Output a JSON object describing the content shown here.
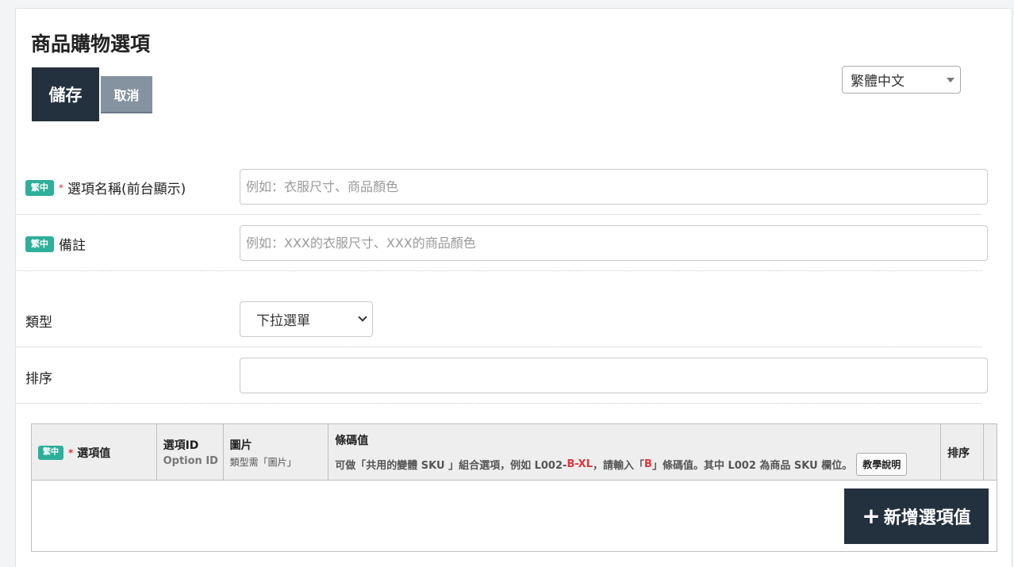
{
  "page": {
    "title": "商品購物選項"
  },
  "toolbar": {
    "save_label": "儲存",
    "cancel_label": "取消"
  },
  "language": {
    "selected": "繁體中文"
  },
  "form": {
    "lang_badge": "繁中",
    "required_mark": "*",
    "option_name": {
      "label": "選項名稱(前台顯示)",
      "placeholder": "例如：衣服尺寸、商品顏色",
      "value": ""
    },
    "remark": {
      "label": "備註",
      "placeholder": "例如：XXX的衣服尺寸、XXX的商品顏色",
      "value": ""
    },
    "type": {
      "label": "類型",
      "selected": "下拉選單"
    },
    "sort": {
      "label": "排序",
      "value": ""
    }
  },
  "options_table": {
    "col_value": "選項值",
    "col_id": "選項ID",
    "col_id_sub": "Option ID",
    "col_image": "圖片",
    "col_image_sub": "類型需「圖片」",
    "col_barcode": "條碼值",
    "barcode_desc_1": "可做「共用的變體 SKU 」組合選項，例如 L002-",
    "barcode_desc_red": "B-XL",
    "barcode_desc_2": "，請輸入「 ",
    "barcode_desc_red2": "B",
    "barcode_desc_3": " 」條碼值。其中 L002 為商品 SKU 欄位。",
    "tutorial_label": "教學說明",
    "col_sort": "排序",
    "add_label": "新增選項值"
  },
  "colors": {
    "primary": "#23303d",
    "secondary": "#8592a0",
    "badge": "#2eaf9a",
    "required": "#e0343a"
  }
}
